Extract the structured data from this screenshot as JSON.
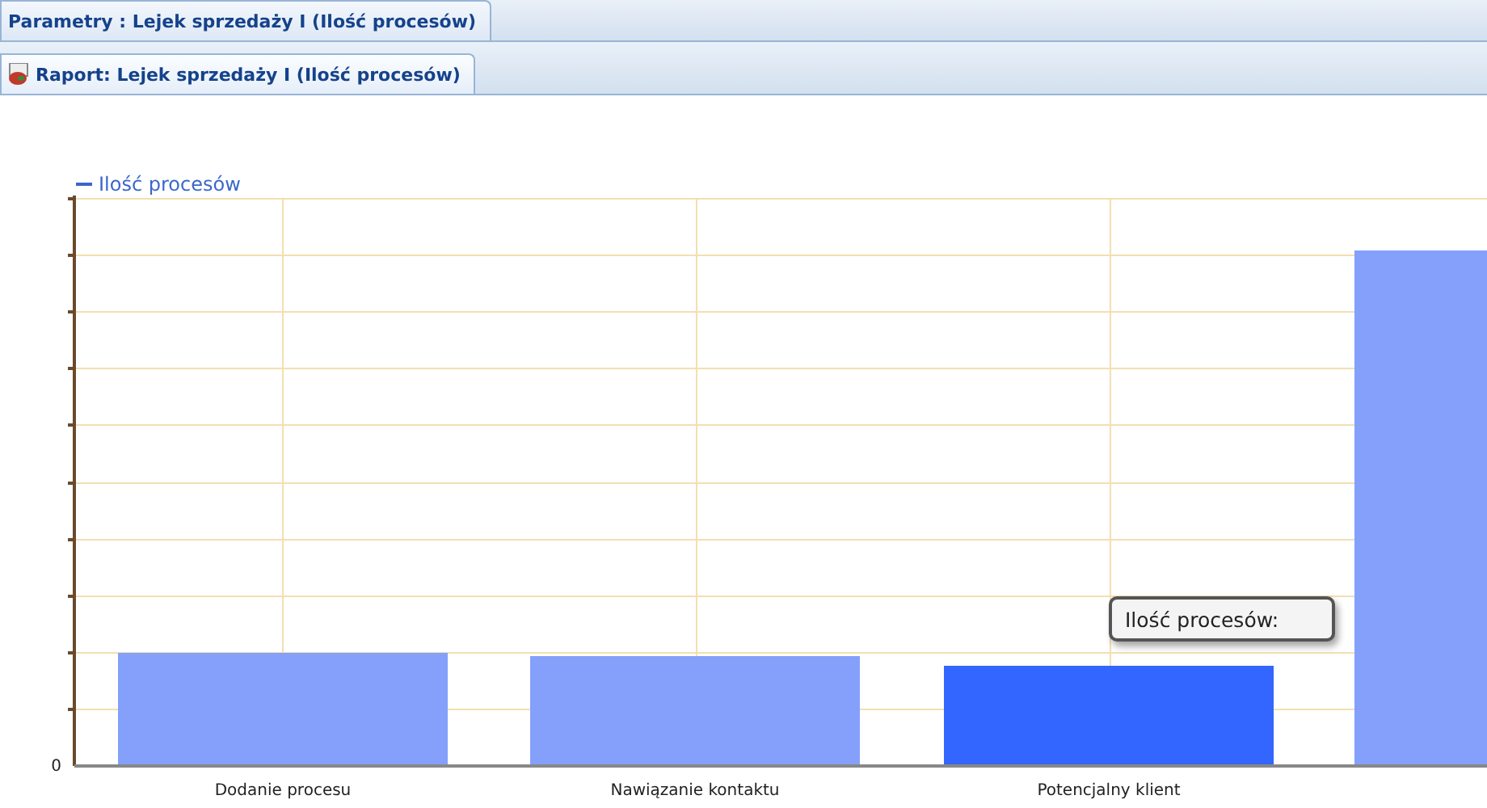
{
  "tabs": [
    {
      "label": "Parametry : Lejek sprzedaży I (Ilość procesów)",
      "kind": "plain"
    },
    {
      "label": "Raport: Lejek sprzedaży I (Ilość procesów)",
      "kind": "report"
    }
  ],
  "chart": {
    "legend": "Ilość procesów",
    "y_zero_tick": "0",
    "categories": [
      {
        "label": "Dodanie procesu",
        "selected": false
      },
      {
        "label": "Nawiązanie kontaktu",
        "selected": false
      },
      {
        "label": "Potencjalny klient",
        "selected": true
      },
      {
        "selected": false
      }
    ],
    "tooltip": {
      "label": "Ilość procesów:"
    }
  }
}
